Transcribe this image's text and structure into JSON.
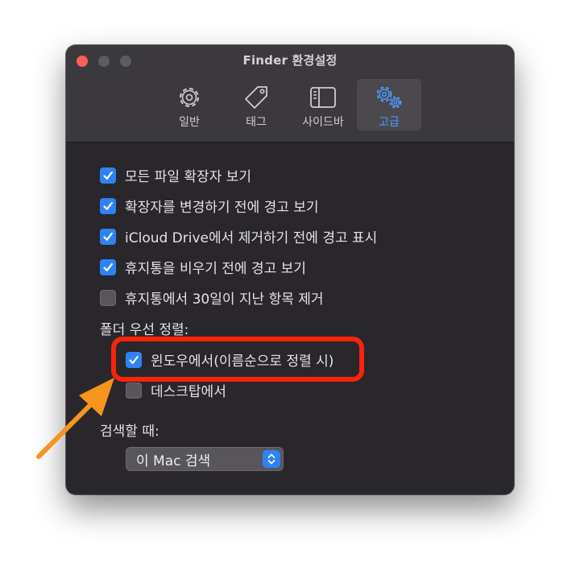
{
  "window": {
    "title": "Finder 환경설정"
  },
  "tabs": [
    {
      "label": "일반",
      "icon": "gear-icon"
    },
    {
      "label": "태그",
      "icon": "tag-icon"
    },
    {
      "label": "사이드바",
      "icon": "sidebar-icon"
    },
    {
      "label": "고급",
      "icon": "gears-icon",
      "active": true
    }
  ],
  "options": [
    {
      "label": "모든 파일 확장자 보기",
      "checked": true
    },
    {
      "label": "확장자를 변경하기 전에 경고 보기",
      "checked": true
    },
    {
      "label": "iCloud Drive에서 제거하기 전에 경고 표시",
      "checked": true
    },
    {
      "label": "휴지통을 비우기 전에 경고 보기",
      "checked": true
    },
    {
      "label": "휴지통에서 30일이 지난 항목 제거",
      "checked": false
    }
  ],
  "folders_first": {
    "heading": "폴더 우선 정렬:",
    "items": [
      {
        "label": "윈도우에서(이름순으로 정렬 시)",
        "checked": true
      },
      {
        "label": "데스크탑에서",
        "checked": false
      }
    ]
  },
  "search": {
    "heading": "검색할 때:",
    "selected": "이 Mac 검색"
  },
  "colors": {
    "accent": "#2f82f4",
    "highlight": "#f5240b",
    "arrow": "#f7941d"
  }
}
